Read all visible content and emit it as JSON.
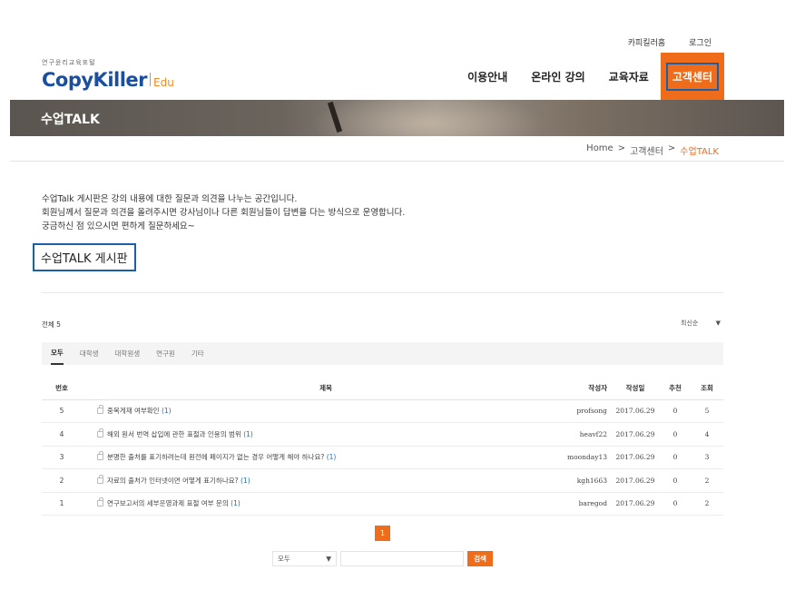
{
  "header": {
    "top_links": [
      "카피킬러홈",
      "로그인"
    ],
    "logo_sub": "연구윤리교육포털",
    "logo_main": "CopyKiller",
    "logo_edu": "Edu",
    "nav": [
      "이용안내",
      "온라인 강의",
      "교육자료",
      "고객센터"
    ]
  },
  "banner": {
    "title": "수업TALK"
  },
  "breadcrumb": [
    "Home",
    ">",
    "고객센터",
    ">",
    "수업TALK"
  ],
  "intro": [
    "수업Talk 게시판은 강의 내용에 대한 질문과 의견을 나누는 공간입니다.",
    "회원님께서 질문과 의견을 올려주시면 강사님이나 다른 회원님들이 답변을 다는 방식으로 운영합니다.",
    "궁금하신 점 있으시면 편하게 질문하세요~"
  ],
  "board_title": "수업TALK 게시판",
  "total": "전체 5",
  "sort": {
    "selected": "최신순",
    "arrow": "▼"
  },
  "tabs": [
    "모두",
    "대학생",
    "대학원생",
    "연구원",
    "기타"
  ],
  "columns": [
    "번호",
    "제목",
    "작성자",
    "작성일",
    "추천",
    "조회"
  ],
  "rows": [
    {
      "no": "5",
      "title": "중복게재 여부확인",
      "count": "(1)",
      "author": "profsong",
      "date": "2017.06.29",
      "rec": "0",
      "view": "5"
    },
    {
      "no": "4",
      "title": "해외 원서 번역 삽입에 관한 표절과 인용의 범위",
      "count": "(1)",
      "author": "heavf22",
      "date": "2017.06.29",
      "rec": "0",
      "view": "4"
    },
    {
      "no": "3",
      "title": "분명한 출처를 표기하려는데 원전에 페이지가 없는 경우 어떻게 해야 하나요?",
      "count": "(1)",
      "author": "moonday13",
      "date": "2017.06.29",
      "rec": "0",
      "view": "3"
    },
    {
      "no": "2",
      "title": "자료의 출처가 인터넷이면 어떻게 표기하나요?",
      "count": "(1)",
      "author": "kgh1663",
      "date": "2017.06.29",
      "rec": "0",
      "view": "2"
    },
    {
      "no": "1",
      "title": "연구보고서의 세부운영과제 표절 여부 문의",
      "count": "(1)",
      "author": "baregod",
      "date": "2017.06.29",
      "rec": "0",
      "view": "2"
    }
  ],
  "pagination": {
    "current": "1"
  },
  "search": {
    "select": "모두",
    "arrow": "▼",
    "button": "검색",
    "value": ""
  }
}
